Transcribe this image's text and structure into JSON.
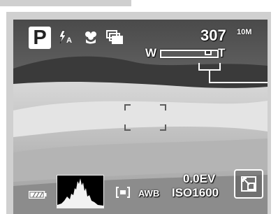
{
  "camera_screen": {
    "mode": "P",
    "shots_remaining": "307",
    "resolution": "10M",
    "zoom": {
      "wide_label": "W",
      "tele_label": "T",
      "level": 0.92
    },
    "exposure_compensation": "0.0EV",
    "iso": {
      "prefix": "ISO",
      "value": "1600"
    },
    "white_balance": "AWB",
    "icons": {
      "flash": "flash-auto-icon",
      "macro": "macro-flower-icon",
      "drive": "continuous-shot-icon",
      "battery": "battery-full-icon",
      "metering": "spot-metering-icon",
      "histogram": "histogram-icon",
      "enlarge": "enlarge-icon"
    }
  },
  "colors": {
    "osd": "#ffffff",
    "frame": "#d0d0d0",
    "sky_top": "#5a5a5a",
    "sand": "#bcbcbc"
  }
}
